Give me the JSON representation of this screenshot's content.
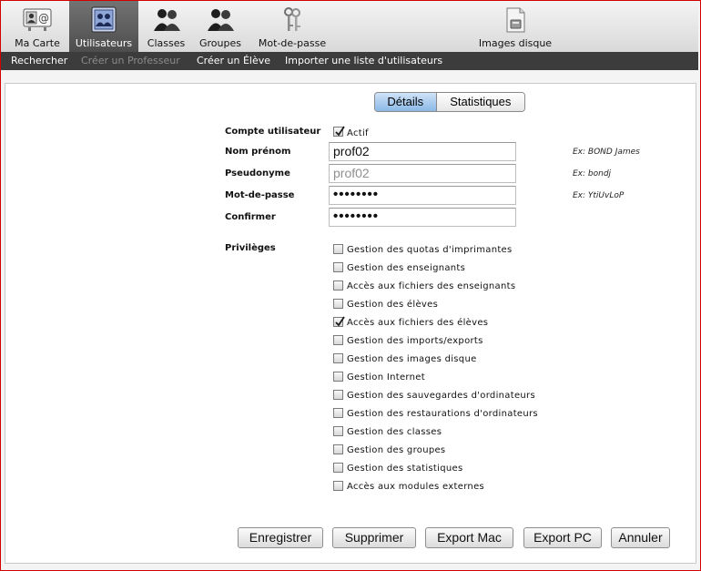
{
  "toolbar": {
    "items": [
      {
        "label": "Ma Carte",
        "icon": "card-icon"
      },
      {
        "label": "Utilisateurs",
        "icon": "users-icon",
        "active": true
      },
      {
        "label": "Classes",
        "icon": "classes-icon"
      },
      {
        "label": "Groupes",
        "icon": "groups-icon"
      },
      {
        "label": "Mot-de-passe",
        "icon": "keys-icon"
      },
      {
        "label": "Images disque",
        "icon": "disk-image-icon"
      }
    ]
  },
  "subnav": {
    "items": [
      {
        "label": "Rechercher",
        "enabled": true
      },
      {
        "label": "Créer un Professeur",
        "enabled": false
      },
      {
        "label": "Créer un Élève",
        "enabled": true
      },
      {
        "label": "Importer une liste d'utilisateurs",
        "enabled": true
      }
    ]
  },
  "tabs": {
    "details": "Détails",
    "stats": "Statistiques",
    "selected": "details"
  },
  "form": {
    "account_label": "Compte utilisateur",
    "active_label": "Actif",
    "active_checked": true,
    "name_label": "Nom prénom",
    "name_value": "prof02",
    "name_hint": "Ex: BOND James",
    "alias_label": "Pseudonyme",
    "alias_value": "prof02",
    "alias_hint": "Ex: bondj",
    "password_label": "Mot-de-passe",
    "password_value": "••••••••",
    "password_hint": "Ex: YtiUvLoP",
    "confirm_label": "Confirmer",
    "confirm_value": "••••••••"
  },
  "privileges": {
    "label": "Privilèges",
    "items": [
      {
        "label": "Gestion des quotas d'imprimantes",
        "checked": false
      },
      {
        "label": "Gestion des enseignants",
        "checked": false
      },
      {
        "label": "Accès aux fichiers des enseignants",
        "checked": false
      },
      {
        "label": "Gestion des élèves",
        "checked": false
      },
      {
        "label": "Accès aux fichiers des élèves",
        "checked": true
      },
      {
        "label": "Gestion des imports/exports",
        "checked": false
      },
      {
        "label": "Gestion des images disque",
        "checked": false
      },
      {
        "label": "Gestion Internet",
        "checked": false
      },
      {
        "label": "Gestion des sauvegardes d'ordinateurs",
        "checked": false
      },
      {
        "label": "Gestion des restaurations d'ordinateurs",
        "checked": false
      },
      {
        "label": "Gestion des classes",
        "checked": false
      },
      {
        "label": "Gestion des groupes",
        "checked": false
      },
      {
        "label": "Gestion des statistiques",
        "checked": false
      },
      {
        "label": "Accès aux modules externes",
        "checked": false
      }
    ]
  },
  "buttons": {
    "save": "Enregistrer",
    "delete": "Supprimer",
    "export_mac": "Export Mac",
    "export_pc": "Export PC",
    "cancel": "Annuler"
  },
  "colors": {
    "frame_border": "#d40000",
    "active_tab": "#5a5a5a",
    "subnav_bg": "#3c3c3c",
    "segment_selected": "#8ab8e6"
  }
}
